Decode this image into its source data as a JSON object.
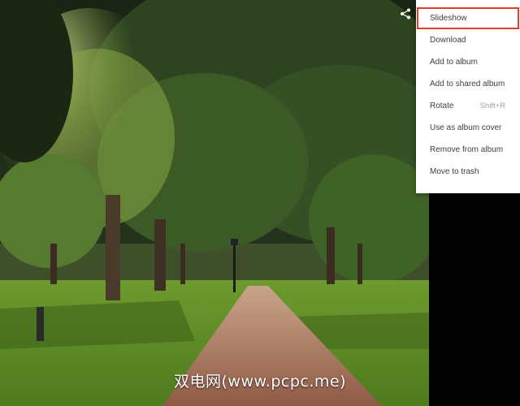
{
  "menu": {
    "items": [
      {
        "label": "Slideshow",
        "shortcut": "",
        "highlighted": true
      },
      {
        "label": "Download",
        "shortcut": ""
      },
      {
        "label": "Add to album",
        "shortcut": ""
      },
      {
        "label": "Add to shared album",
        "shortcut": ""
      },
      {
        "label": "Rotate",
        "shortcut": "Shift+R"
      },
      {
        "label": "Use as album cover",
        "shortcut": ""
      },
      {
        "label": "Remove from album",
        "shortcut": ""
      },
      {
        "label": "Move to trash",
        "shortcut": ""
      }
    ]
  },
  "toolbar": {
    "share_icon": "share-icon"
  },
  "watermark": {
    "text": "双电网(www.pcpc.me)"
  },
  "colors": {
    "highlight_border": "#e0402a",
    "menu_text": "#3c4043",
    "shortcut_text": "#9aa0a6"
  }
}
